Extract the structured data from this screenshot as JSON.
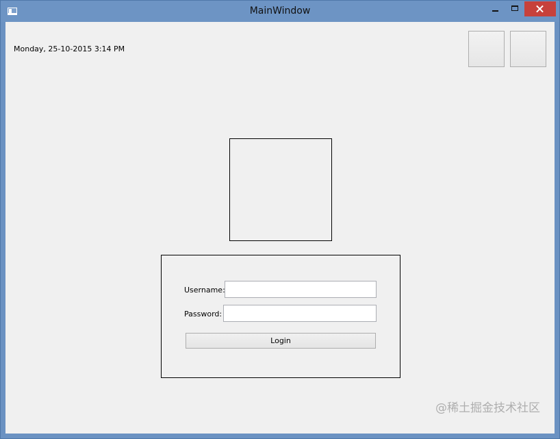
{
  "window": {
    "title": "MainWindow"
  },
  "header": {
    "datetime": "Monday, 25-10-2015 3:14 PM"
  },
  "login": {
    "username_label": "Username:",
    "username_value": "",
    "password_label": "Password:",
    "password_value": "",
    "login_label": "Login"
  },
  "watermark": "@稀土掘金技术社区",
  "icons": {
    "app": "app-window-icon",
    "minimize": "minimize-icon",
    "maximize": "maximize-icon",
    "close": "close-icon"
  },
  "colors": {
    "titlebar": "#6d94c4",
    "close_button": "#c7413b",
    "client_background": "#f0f0f0"
  }
}
